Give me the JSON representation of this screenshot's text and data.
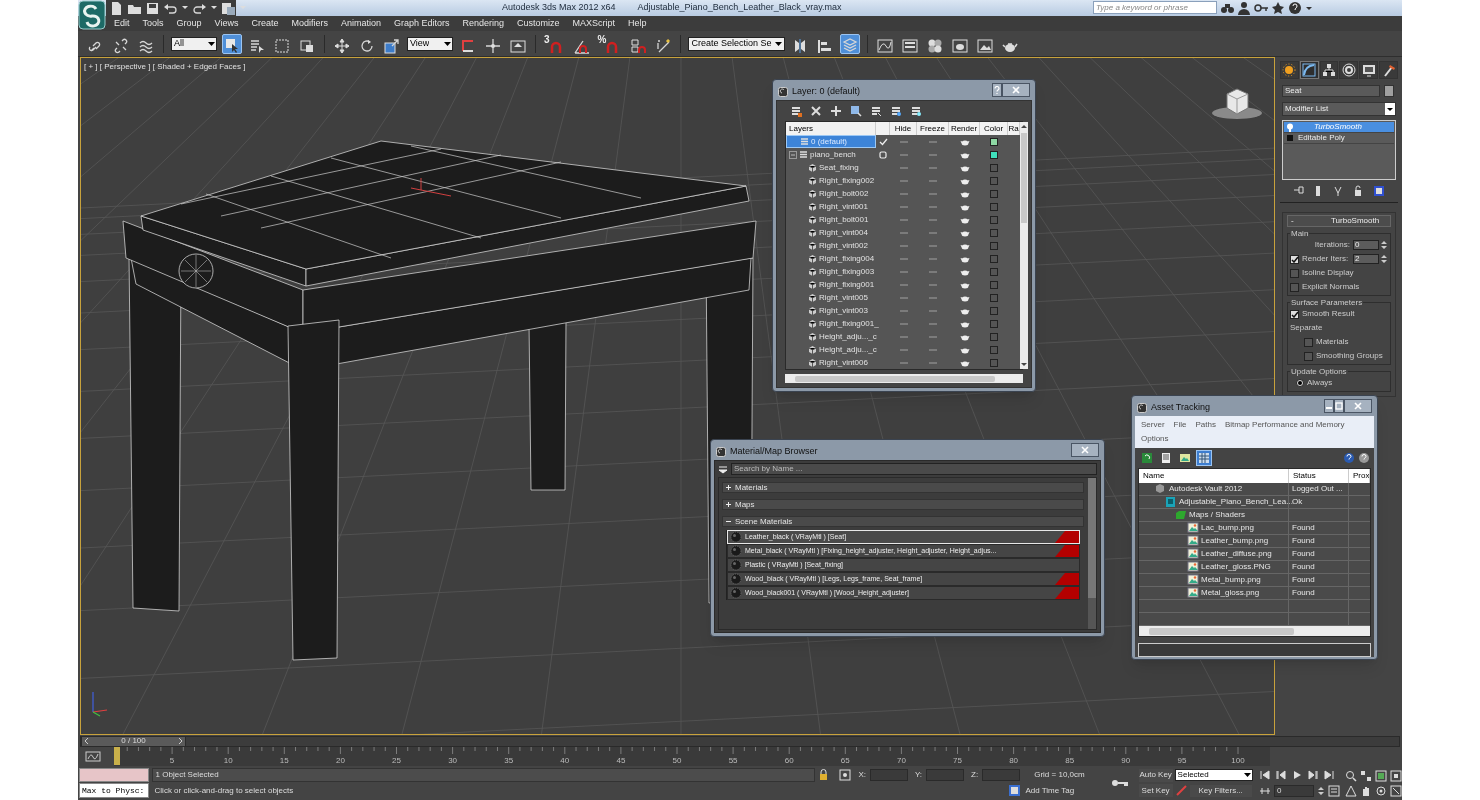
{
  "window": {
    "app_title": "Autodesk 3ds Max 2012 x64",
    "file_name": "Adjustable_Piano_Bench_Leather_Black_vray.max"
  },
  "search": {
    "placeholder": "Type a keyword or phrase"
  },
  "menu": [
    "Edit",
    "Tools",
    "Group",
    "Views",
    "Create",
    "Modifiers",
    "Animation",
    "Graph Editors",
    "Rendering",
    "Customize",
    "MAXScript",
    "Help"
  ],
  "toolbar": [
    {
      "kind": "link",
      "selected": false
    },
    {
      "kind": "unlink",
      "selected": false
    },
    {
      "kind": "bind",
      "selected": false
    },
    {
      "kind": "dropdown",
      "value": "All"
    },
    {
      "kind": "select",
      "selected": true
    },
    {
      "kind": "select_name",
      "selected": false
    },
    {
      "kind": "rect_region",
      "selected": false
    },
    {
      "kind": "window_crossing",
      "selected": false
    },
    {
      "kind": "move",
      "selected": false
    },
    {
      "kind": "rotate",
      "selected": false
    },
    {
      "kind": "scale",
      "selected": false
    },
    {
      "kind": "dropdown",
      "value": "View"
    },
    {
      "kind": "pivot",
      "selected": false
    },
    {
      "kind": "manipulate",
      "selected": false
    },
    {
      "kind": "keyboard",
      "selected": false
    },
    {
      "kind": "snap",
      "label": "3",
      "selected": false
    },
    {
      "kind": "angle_snap",
      "selected": false
    },
    {
      "kind": "percent_snap",
      "label": "%",
      "selected": false
    },
    {
      "kind": "spinner_snap",
      "selected": false
    },
    {
      "kind": "edit_named",
      "selected": false
    },
    {
      "kind": "dropdown",
      "value": "Create Selection Se"
    },
    {
      "kind": "mirror",
      "selected": false
    },
    {
      "kind": "align",
      "selected": false
    },
    {
      "kind": "layer_manager",
      "selected": true
    },
    {
      "kind": "curve_editor",
      "selected": false
    },
    {
      "kind": "schematic",
      "selected": false
    },
    {
      "kind": "material_editor",
      "selected": false
    },
    {
      "kind": "render_setup",
      "selected": false
    },
    {
      "kind": "rendered_frame",
      "selected": false
    },
    {
      "kind": "render",
      "selected": false
    }
  ],
  "viewport": {
    "label": "[ + ] [ Perspective ] [ Shaded + Edged Faces ]"
  },
  "layer_dialog": {
    "title": "Layer: 0 (default)",
    "columns": [
      "Layers",
      "Hide",
      "Freeze",
      "Render",
      "Color",
      "Ra"
    ],
    "layers": [
      {
        "name": "0 (default)",
        "selected": true,
        "current": true,
        "hidden": false,
        "frozen": false,
        "color": "#8ed8a4"
      },
      {
        "name": "piano_bench",
        "selected": false,
        "current": false,
        "hidden": false,
        "frozen": false,
        "color": "#3fe0bc",
        "expanded": true,
        "children": [
          {
            "name": "Seat_fixing",
            "hidden": false,
            "frozen": false
          },
          {
            "name": "Right_fixing002",
            "hidden": false,
            "frozen": false
          },
          {
            "name": "Right_bolt002",
            "hidden": false,
            "frozen": false
          },
          {
            "name": "Right_vint001",
            "hidden": false,
            "frozen": false
          },
          {
            "name": "Right_bolt001",
            "hidden": false,
            "frozen": false
          },
          {
            "name": "Right_vint004",
            "hidden": false,
            "frozen": false
          },
          {
            "name": "Right_vint002",
            "hidden": false,
            "frozen": false
          },
          {
            "name": "Right_fixing004",
            "hidden": false,
            "frozen": false
          },
          {
            "name": "Right_fixing003",
            "hidden": false,
            "frozen": false
          },
          {
            "name": "Right_fixing001",
            "hidden": false,
            "frozen": false
          },
          {
            "name": "Right_vint005",
            "hidden": false,
            "frozen": false
          },
          {
            "name": "Right_vint003",
            "hidden": false,
            "frozen": false
          },
          {
            "name": "Right_fixing001_",
            "hidden": false,
            "frozen": false
          },
          {
            "name": "Height_adju..._c",
            "hidden": false,
            "frozen": false
          },
          {
            "name": "Height_adju..._c",
            "hidden": false,
            "frozen": false
          },
          {
            "name": "Right_vint006",
            "hidden": false,
            "frozen": false
          }
        ]
      }
    ]
  },
  "command_panel": {
    "tabs": [
      {
        "kind": "create",
        "selected": false
      },
      {
        "kind": "modify",
        "selected": true
      },
      {
        "kind": "hierarchy",
        "selected": false
      },
      {
        "kind": "motion",
        "selected": false
      },
      {
        "kind": "display",
        "selected": false
      },
      {
        "kind": "utilities",
        "selected": false
      }
    ],
    "object_name": "Seat",
    "modifier_list": "Modifier List",
    "stack": [
      {
        "name": "TurboSmooth",
        "selected": true
      },
      {
        "name": "Editable Poly",
        "selected": false
      }
    ],
    "rollout": {
      "toggle": "-",
      "title": "TurboSmooth",
      "groups": [
        {
          "title": "Main",
          "controls": [
            {
              "kind": "spinner",
              "label": "Iterations:",
              "value": "0"
            },
            {
              "kind": "checkspinner",
              "label": "Render Iters:",
              "value": "2",
              "checked": true
            },
            {
              "kind": "checkbox",
              "label": "Isoline Display",
              "checked": false
            },
            {
              "kind": "checkbox",
              "label": "Explicit Normals",
              "checked": false
            }
          ]
        },
        {
          "title": "Surface Parameters",
          "controls": [
            {
              "kind": "checkbox",
              "label": "Smooth Result",
              "checked": true
            },
            {
              "kind": "text",
              "label": "Separate"
            },
            {
              "kind": "subcheckbox",
              "label": "Materials",
              "checked": false
            },
            {
              "kind": "subcheckbox",
              "label": "Smoothing Groups",
              "checked": false
            }
          ]
        },
        {
          "title": "Update Options",
          "controls": [
            {
              "kind": "radio",
              "label": "Always",
              "selected": true
            }
          ]
        }
      ]
    }
  },
  "material_browser": {
    "title": "Material/Map Browser",
    "placeholder": "Search by Name ...",
    "sections": [
      {
        "label": "Materials",
        "expanded": false
      },
      {
        "label": "Maps",
        "expanded": false
      },
      {
        "label": "Scene Materials",
        "expanded": true
      }
    ],
    "materials": [
      {
        "text": "Leather_black  ( VRayMtl ) [Seat]",
        "selected": true,
        "flagged": true
      },
      {
        "text": "Metal_black  ( VRayMtl ) [Fixing_height_adjuster, Height_adjuster, Height_adjus...",
        "selected": false,
        "flagged": true
      },
      {
        "text": "Plastic  ( VRayMtl ) [Seat_fixing]",
        "selected": false,
        "flagged": false
      },
      {
        "text": "Wood_black  ( VRayMtl ) [Legs, Legs_frame, Seat_frame]",
        "selected": false,
        "flagged": true
      },
      {
        "text": "Wood_black001  ( VRayMtl ) [Wood_Height_adjuster]",
        "selected": false,
        "flagged": true
      }
    ]
  },
  "asset_tracking": {
    "title": "Asset Tracking",
    "menu": [
      "Server",
      "File",
      "Paths",
      "Bitmap Performance and Memory",
      "Options"
    ],
    "toolbar": [
      {
        "kind": "refresh",
        "selected": false
      },
      {
        "kind": "list",
        "selected": false
      },
      {
        "kind": "thumbnails",
        "selected": false
      },
      {
        "kind": "table",
        "selected": true
      }
    ],
    "columns": [
      "Name",
      "Status",
      "Prox"
    ],
    "rows": [
      {
        "kind": "vault",
        "name": "Autodesk Vault 2012",
        "status": "Logged Out ...",
        "children": [
          {
            "kind": "scene",
            "name": "Adjustable_Piano_Bench_Lea...",
            "status": "Ok",
            "children": [
              {
                "kind": "folder",
                "name": "Maps / Shaders",
                "children": [
                  {
                    "kind": "bitmap",
                    "name": "Lac_bump.png",
                    "status": "Found"
                  },
                  {
                    "kind": "bitmap",
                    "name": "Leather_bump.png",
                    "status": "Found"
                  },
                  {
                    "kind": "bitmap",
                    "name": "Leather_diffuse.png",
                    "status": "Found"
                  },
                  {
                    "kind": "bitmap",
                    "name": "Leather_gloss.PNG",
                    "status": "Found"
                  },
                  {
                    "kind": "bitmap",
                    "name": "Metal_bump.png",
                    "status": "Found"
                  },
                  {
                    "kind": "bitmap",
                    "name": "Metal_gloss.png",
                    "status": "Found"
                  }
                ]
              }
            ]
          }
        ]
      }
    ]
  },
  "timeline": {
    "position": "0 / 100",
    "frame_labels": [
      "5",
      "10",
      "15",
      "20",
      "25",
      "30",
      "35",
      "40",
      "45",
      "50",
      "55",
      "60",
      "65",
      "70",
      "75",
      "80",
      "85",
      "90",
      "95",
      "100"
    ]
  },
  "status_bar": {
    "listener": "Max to Physc:",
    "selection": "1 Object Selected",
    "prompt": "Click or click-and-drag to select objects",
    "coords": [
      "X:",
      "Y:",
      "Z:"
    ],
    "grid": "Grid = 10,0cm",
    "time_tag": "Add Time Tag",
    "auto_key": "Auto Key",
    "key_mode": "Selected",
    "set_key": "Set Key",
    "key_filters": "Key Filters...",
    "frame": "0"
  }
}
